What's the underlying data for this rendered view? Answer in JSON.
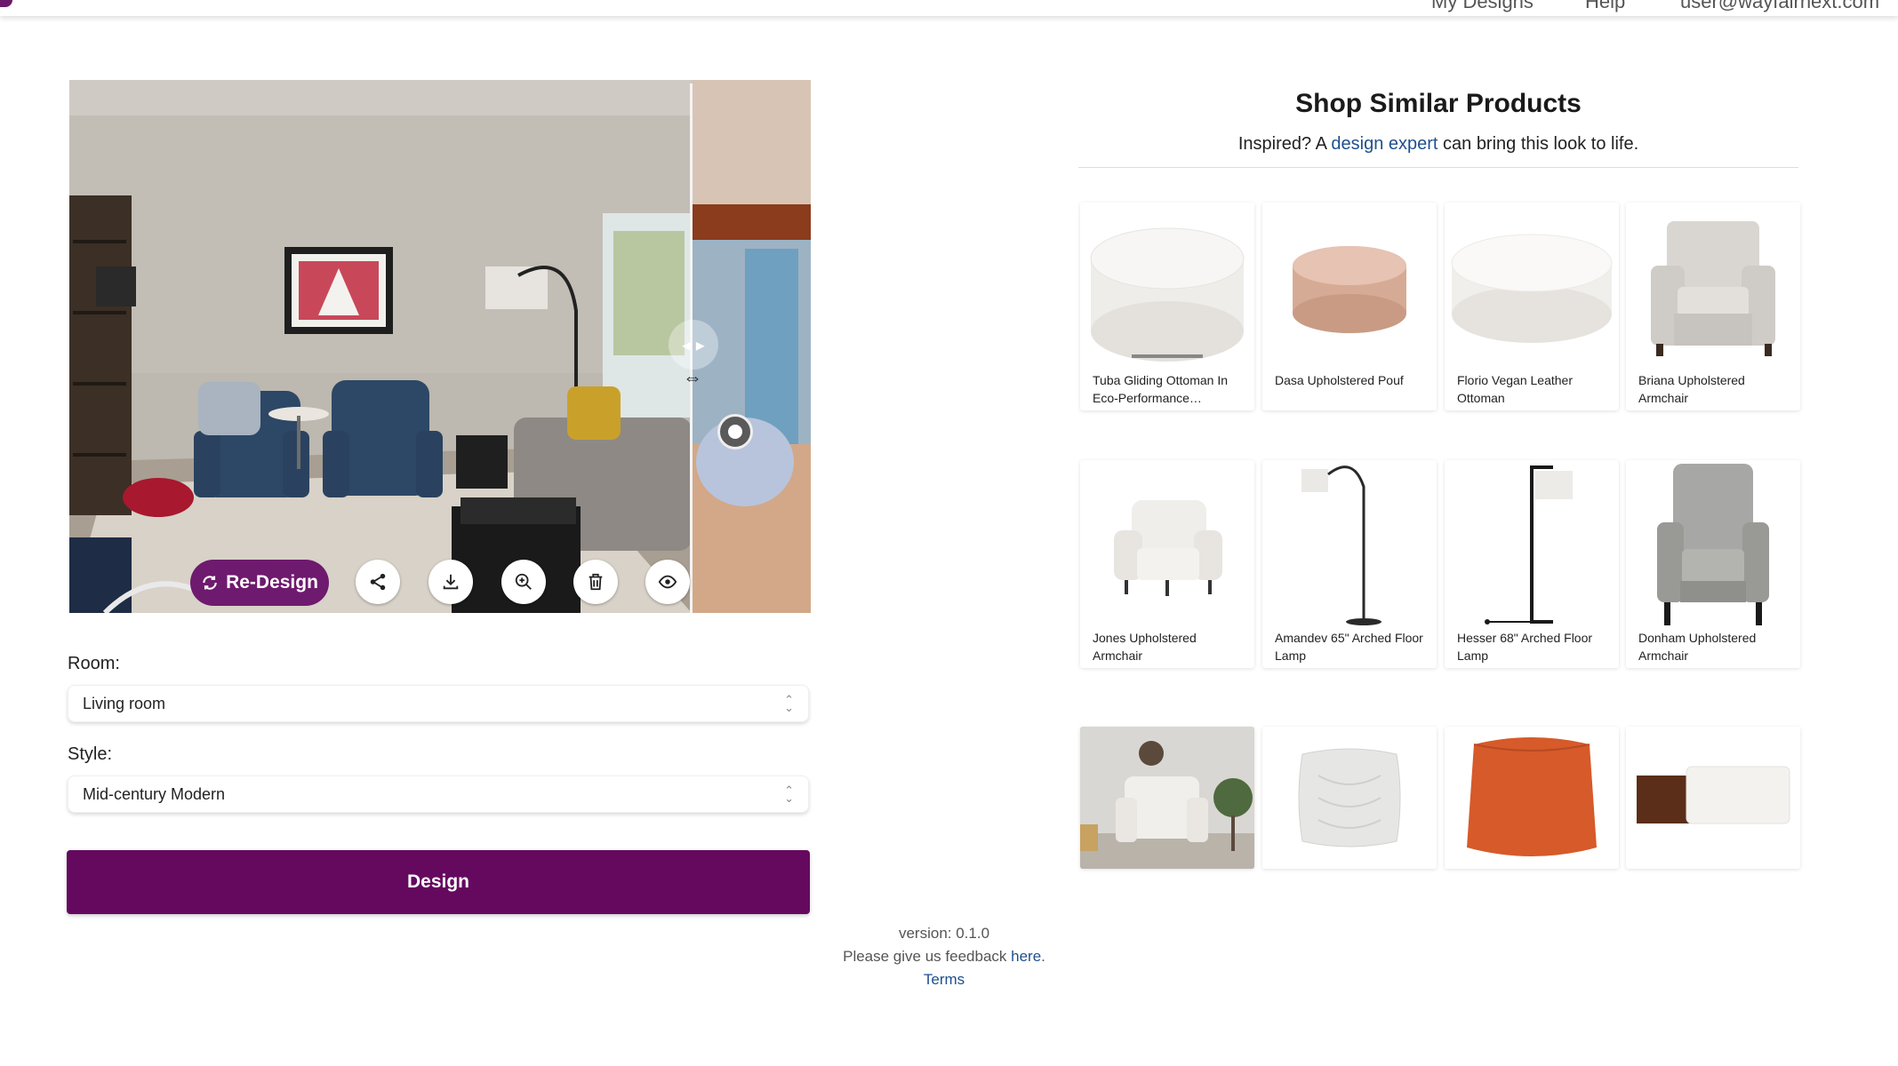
{
  "nav": {
    "logo": "",
    "items": [
      "My Designs",
      "Help",
      "user@wayfairnext.com"
    ]
  },
  "viewer": {
    "redesign_label": "Re-Design",
    "actions": [
      "share-icon",
      "download-icon",
      "zoom-icon",
      "trash-icon",
      "eye-icon"
    ]
  },
  "form": {
    "room_label": "Room:",
    "room_value": "Living room",
    "style_label": "Style:",
    "style_value": "Mid-century Modern",
    "design_label": "Design"
  },
  "footer": {
    "version": "version: 0.1.0",
    "feedback_prefix": "Please give us feedback ",
    "feedback_link": "here",
    "feedback_suffix": ".",
    "terms": "Terms"
  },
  "shop": {
    "title": "Shop Similar Products",
    "sub_prefix": "Inspired? A ",
    "sub_link": "design expert",
    "sub_suffix": " can bring this look to life.",
    "products": [
      {
        "name": "Tuba Gliding Ottoman In Eco-Performance…",
        "icon": "round-ottoman-white"
      },
      {
        "name": "Dasa Upholstered Pouf",
        "icon": "round-pouf-pink"
      },
      {
        "name": "Florio Vegan Leather Ottoman",
        "icon": "round-ottoman-white"
      },
      {
        "name": "Briana Upholstered Armchair",
        "icon": "armchair-grey"
      },
      {
        "name": "Jones Upholstered Armchair",
        "icon": "armchair-white"
      },
      {
        "name": "Amandev 65\" Arched Floor Lamp",
        "icon": "arched-lamp"
      },
      {
        "name": "Hesser 68\" Arched Floor Lamp",
        "icon": "floor-lamp"
      },
      {
        "name": "Donham Upholstered Armchair",
        "icon": "armchair-grey"
      },
      {
        "name": "",
        "icon": "armchair-room"
      },
      {
        "name": "",
        "icon": "pillow"
      },
      {
        "name": "",
        "icon": "cube-pouf-orange"
      },
      {
        "name": "",
        "icon": "bench-ottoman"
      }
    ]
  },
  "colors": {
    "brand": "#65095f",
    "link": "#1f4f8f"
  }
}
